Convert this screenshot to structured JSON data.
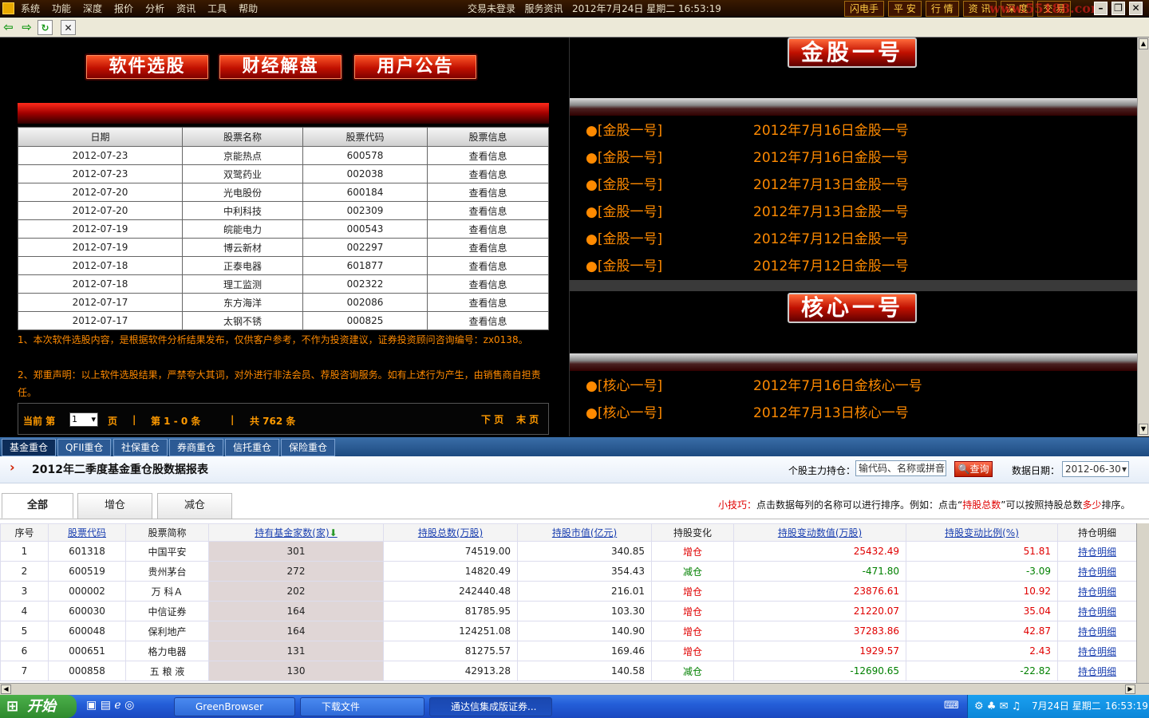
{
  "menubar": {
    "items": [
      "系统",
      "功能",
      "深度",
      "报价",
      "分析",
      "资讯",
      "工具",
      "帮助"
    ],
    "status": "交易未登录",
    "info": "服务资讯",
    "datetime": "2012年7月24日 星期二 16:53:19",
    "quick": [
      "闪电手",
      "平 安",
      "行 情",
      "资 讯",
      "深 度",
      "交 易"
    ],
    "watermark": "www.55188.com"
  },
  "left": {
    "buttons": [
      "软件选股",
      "财经解盘",
      "用户公告"
    ],
    "headers": [
      "日期",
      "股票名称",
      "股票代码",
      "股票信息"
    ],
    "rows": [
      [
        "2012-07-23",
        "京能热点",
        "600578",
        "查看信息"
      ],
      [
        "2012-07-23",
        "双鹭药业",
        "002038",
        "查看信息"
      ],
      [
        "2012-07-20",
        "光电股份",
        "600184",
        "查看信息"
      ],
      [
        "2012-07-20",
        "中利科技",
        "002309",
        "查看信息"
      ],
      [
        "2012-07-19",
        "皖能电力",
        "000543",
        "查看信息"
      ],
      [
        "2012-07-19",
        "博云新材",
        "002297",
        "查看信息"
      ],
      [
        "2012-07-18",
        "正泰电器",
        "601877",
        "查看信息"
      ],
      [
        "2012-07-18",
        "理工监测",
        "002322",
        "查看信息"
      ],
      [
        "2012-07-17",
        "东方海洋",
        "002086",
        "查看信息"
      ],
      [
        "2012-07-17",
        "太钢不锈",
        "000825",
        "查看信息"
      ]
    ],
    "note1": "1、本次软件选股内容，是根据软件分析结果发布，仅供客户参考，不作为投资建议，证券投资顾问咨询编号：zx0138。",
    "note2": "2、郑重声明：以上软件选股结果，严禁夸大其词，对外进行非法会员、荐股咨询服务。如有上述行为产生，由销售商自担责任。",
    "pager": {
      "current_label": "当前 第",
      "page": "1",
      "page_unit": "页",
      "range": "第 1 - 0 条",
      "total": "共 762 条",
      "next": "下 页",
      "last": "末 页"
    }
  },
  "right": {
    "banner1": "金股一号",
    "news1": [
      {
        "cat": "[金股一号]",
        "title": "2012年7月16日金股一号"
      },
      {
        "cat": "[金股一号]",
        "title": "2012年7月16日金股一号"
      },
      {
        "cat": "[金股一号]",
        "title": "2012年7月13日金股一号"
      },
      {
        "cat": "[金股一号]",
        "title": "2012年7月13日金股一号"
      },
      {
        "cat": "[金股一号]",
        "title": "2012年7月12日金股一号"
      },
      {
        "cat": "[金股一号]",
        "title": "2012年7月12日金股一号"
      }
    ],
    "banner2": "核心一号",
    "news2": [
      {
        "cat": "[核心一号]",
        "title": "2012年7月16日金核心一号"
      },
      {
        "cat": "[核心一号]",
        "title": "2012年7月13日核心一号"
      }
    ]
  },
  "tabs": [
    "基金重仓",
    "QFII重仓",
    "社保重仓",
    "券商重仓",
    "信托重仓",
    "保险重仓"
  ],
  "report": {
    "title": "2012年二季度基金重仓股数据报表",
    "search_label": "个股主力持仓：",
    "search_placeholder": "输代码、名称或拼音",
    "query_btn": "查询",
    "date_label": "数据日期：",
    "date_value": "2012-06-30",
    "subtabs": [
      "全部",
      "增仓",
      "减仓"
    ],
    "tip_label": "小技巧：",
    "tip_text1": "点击数据每列的名称可以进行排序。例如：点击“",
    "tip_key": "持股总数",
    "tip_text2": "”可以按照持股总数",
    "tip_key2": "多少",
    "tip_text3": "排序。",
    "columns": [
      "序号",
      "股票代码",
      "股票简称",
      "持有基金家数(家)",
      "持股总数(万股)",
      "持股市值(亿元)",
      "持股变化",
      "持股变动数值(万股)",
      "持股变动比例(%)",
      "持仓明细"
    ],
    "rows": [
      [
        "1",
        "601318",
        "中国平安",
        "301",
        "74519.00",
        "340.85",
        "增仓",
        "25432.49",
        "51.81",
        "持仓明细"
      ],
      [
        "2",
        "600519",
        "贵州茅台",
        "272",
        "14820.49",
        "354.43",
        "减仓",
        "-471.80",
        "-3.09",
        "持仓明细"
      ],
      [
        "3",
        "000002",
        "万 科Ａ",
        "202",
        "242440.48",
        "216.01",
        "增仓",
        "23876.61",
        "10.92",
        "持仓明细"
      ],
      [
        "4",
        "600030",
        "中信证券",
        "164",
        "81785.95",
        "103.30",
        "增仓",
        "21220.07",
        "35.04",
        "持仓明细"
      ],
      [
        "5",
        "600048",
        "保利地产",
        "164",
        "124251.08",
        "140.90",
        "增仓",
        "37283.86",
        "42.87",
        "持仓明细"
      ],
      [
        "6",
        "000651",
        "格力电器",
        "131",
        "81275.57",
        "169.46",
        "增仓",
        "1929.57",
        "2.43",
        "持仓明细"
      ],
      [
        "7",
        "000858",
        "五 粮 液",
        "130",
        "42913.28",
        "140.58",
        "减仓",
        "-12690.65",
        "-22.82",
        "持仓明细"
      ]
    ]
  },
  "taskbar": {
    "start": "开始",
    "items": [
      "GreenBrowser",
      "下载文件",
      "通达信集成版证券..."
    ],
    "clock": "16:53:19",
    "date": "7月24日 星期二"
  }
}
